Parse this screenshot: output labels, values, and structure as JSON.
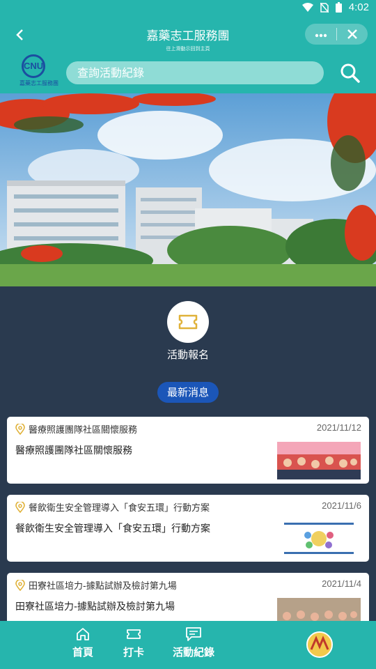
{
  "status_bar": {
    "time": "4:02"
  },
  "header": {
    "title": "嘉藥志工服務團",
    "subtitle": "往上滑動示回到主頁",
    "more_icon": "more-dots-icon",
    "close_icon": "close-icon",
    "back_icon": "back-arrow-icon"
  },
  "logo": {
    "letters": "CNU",
    "name": "嘉藥志工服務團"
  },
  "search": {
    "placeholder": "查詢活動紀錄"
  },
  "features": {
    "register_label": "活動報名"
  },
  "news": {
    "badge": "最新消息",
    "items": [
      {
        "title": "醫療照護團隊社區關懷服務",
        "date": "2021/11/12",
        "desc": "醫療照護團隊社區關懷服務"
      },
      {
        "title": "餐飲衛生安全管理導入「食安五環」行動方案",
        "date": "2021/11/6",
        "desc": "餐飲衛生安全管理導入「食安五環」行動方案"
      },
      {
        "title": "田寮社區培力-據點試辦及檢討第九場",
        "date": "2021/11/4",
        "desc": "田寮社區培力-據點試辦及檢討第九場"
      }
    ]
  },
  "tabbar": {
    "home": "首頁",
    "checkin": "打卡",
    "records": "活動紀錄"
  },
  "colors": {
    "primary": "#26b5ad",
    "badge": "#1b56b8",
    "background": "#2a3a4f"
  }
}
